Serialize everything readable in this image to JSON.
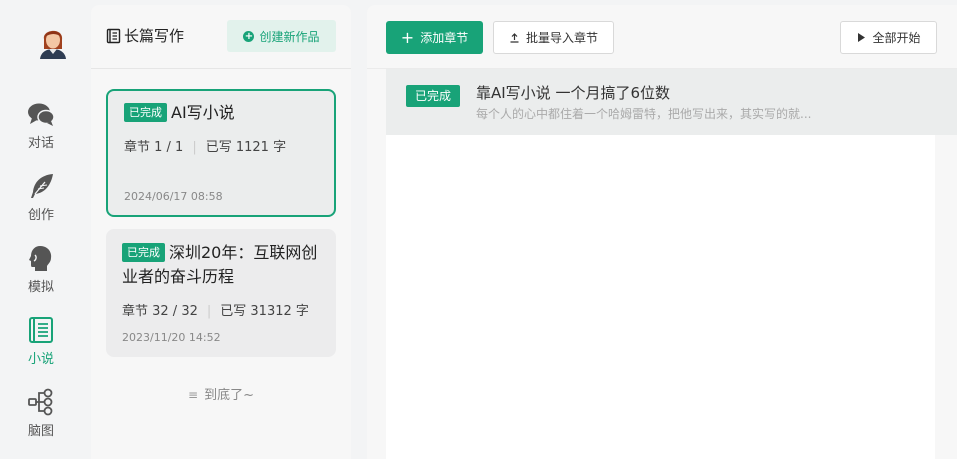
{
  "nav": {
    "items": [
      {
        "label": "对话",
        "icon": "chat-bubbles-icon"
      },
      {
        "label": "创作",
        "icon": "feather-icon"
      },
      {
        "label": "模拟",
        "icon": "head-silhouette-icon"
      },
      {
        "label": "小说",
        "icon": "book-icon",
        "active": true
      },
      {
        "label": "脑图",
        "icon": "mindmap-icon"
      }
    ]
  },
  "works": {
    "title": "长篇写作",
    "create_label": "创建新作品",
    "items": [
      {
        "status": "已完成",
        "title": "AI写小说",
        "chapters_label": "章节 1 / 1",
        "words_label": "已写 1121 字",
        "date": "2024/06/17 08:58",
        "selected": true
      },
      {
        "status": "已完成",
        "title": "深圳20年：互联网创业者的奋斗历程",
        "chapters_label": "章节 32 / 32",
        "words_label": "已写 31312 字",
        "date": "2023/11/20 14:52",
        "selected": false
      }
    ],
    "end_note": "到底了~"
  },
  "toolbar": {
    "add_label": "添加章节",
    "import_label": "批量导入章节",
    "start_label": "全部开始"
  },
  "chapters": [
    {
      "status": "已完成",
      "title": "靠AI写小说 一个月搞了6位数",
      "preview": "每个人的心中都住着一个哈姆雷特，把他写出来，其实写的就..."
    }
  ],
  "colors": {
    "accent": "#18a378",
    "accent_light": "#e2f2ec",
    "panel_bg": "#f7f7f7",
    "app_bg": "#f3f4f5"
  }
}
